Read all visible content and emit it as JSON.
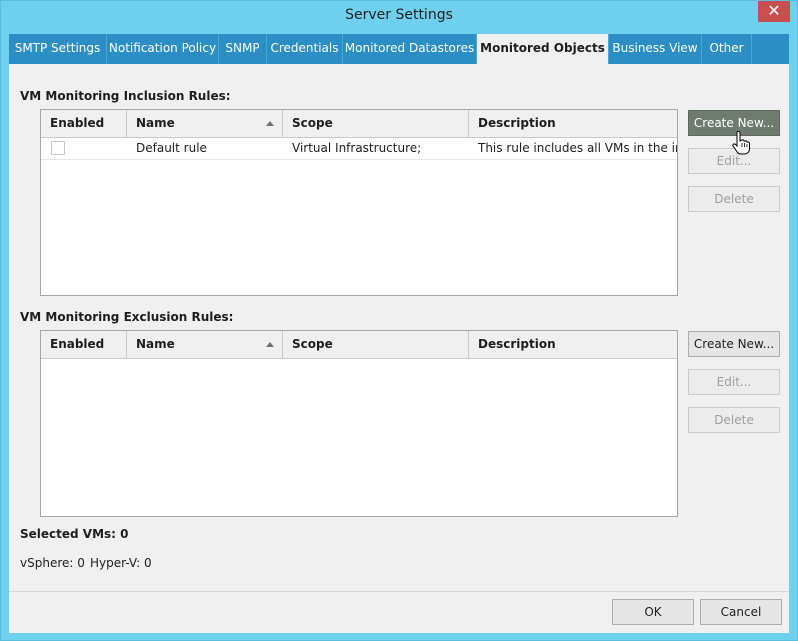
{
  "window": {
    "title": "Server Settings",
    "close_icon": "close-icon"
  },
  "tabs": [
    {
      "label": "SMTP Settings"
    },
    {
      "label": "Notification Policy"
    },
    {
      "label": "SNMP"
    },
    {
      "label": "Credentials"
    },
    {
      "label": "Monitored Datastores"
    },
    {
      "label": "Monitored Objects",
      "active": true
    },
    {
      "label": "Business View"
    },
    {
      "label": "Other"
    }
  ],
  "inclusion": {
    "heading": "VM Monitoring Inclusion Rules:",
    "columns": [
      "Enabled",
      "Name",
      "Scope",
      "Description"
    ],
    "rows": [
      {
        "enabled": false,
        "name": "Default rule",
        "scope": "Virtual Infrastructure;",
        "description": "This rule includes all VMs in the in..."
      }
    ],
    "buttons": {
      "create": "Create New...",
      "edit": "Edit...",
      "delete": "Delete"
    }
  },
  "exclusion": {
    "heading": "VM Monitoring Exclusion Rules:",
    "columns": [
      "Enabled",
      "Name",
      "Scope",
      "Description"
    ],
    "rows": [],
    "buttons": {
      "create": "Create New...",
      "edit": "Edit...",
      "delete": "Delete"
    }
  },
  "summary": {
    "selected_label": "Selected VMs: 0",
    "vsphere": "vSphere: 0",
    "hyperv": "Hyper-V: 0"
  },
  "footer": {
    "ok": "OK",
    "cancel": "Cancel"
  },
  "colors": {
    "title_bar": "#6fd0ee",
    "tab_strip": "#2b8fc6",
    "close": "#c74f4f",
    "hover_button": "#6f7b6f"
  }
}
